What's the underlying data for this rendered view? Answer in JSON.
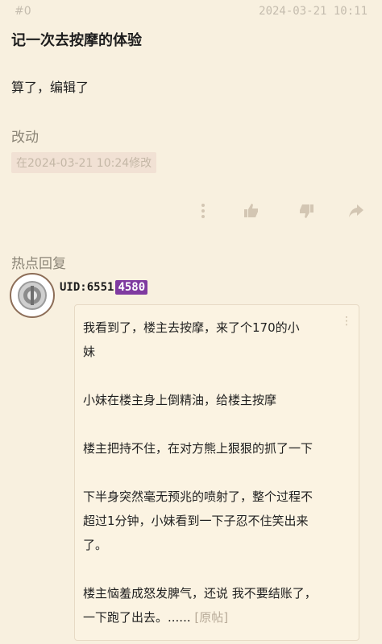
{
  "post": {
    "floor": "#0",
    "timestamp": "2024-03-21 10:11",
    "title": "记一次去按摩的体验",
    "body": "算了，编辑了",
    "section_label": "改动",
    "edit_note": "在2024-03-21 10:24修改"
  },
  "actions": {
    "icons": [
      "more-icon",
      "thumbs-up-icon",
      "thumbs-down-icon",
      "share-icon"
    ]
  },
  "hot_replies": {
    "label": "热点回复",
    "user": {
      "uid_label": "UID:6551",
      "badge": "4580"
    },
    "quote": {
      "lines": [
        "我看到了，楼主去按摩，来了个170的小",
        "妹",
        "小妹在楼主身上倒精油，给楼主按摩",
        "楼主把持不住，在对方熊上狠狠的抓了一下",
        "下半身突然毫无预兆的喷射了，整个过程不",
        "超过1分钟，小妹看到一下子忍不住笑出来",
        "了。",
        "楼主恼羞成怒发脾气，还说 我不要结账了，",
        "一下跑了出去。......"
      ],
      "origin_link": "[原帖]"
    }
  },
  "colors": {
    "background": "#f8f0df",
    "badge": "#7f3aa0",
    "muted": "#c4bcae"
  }
}
